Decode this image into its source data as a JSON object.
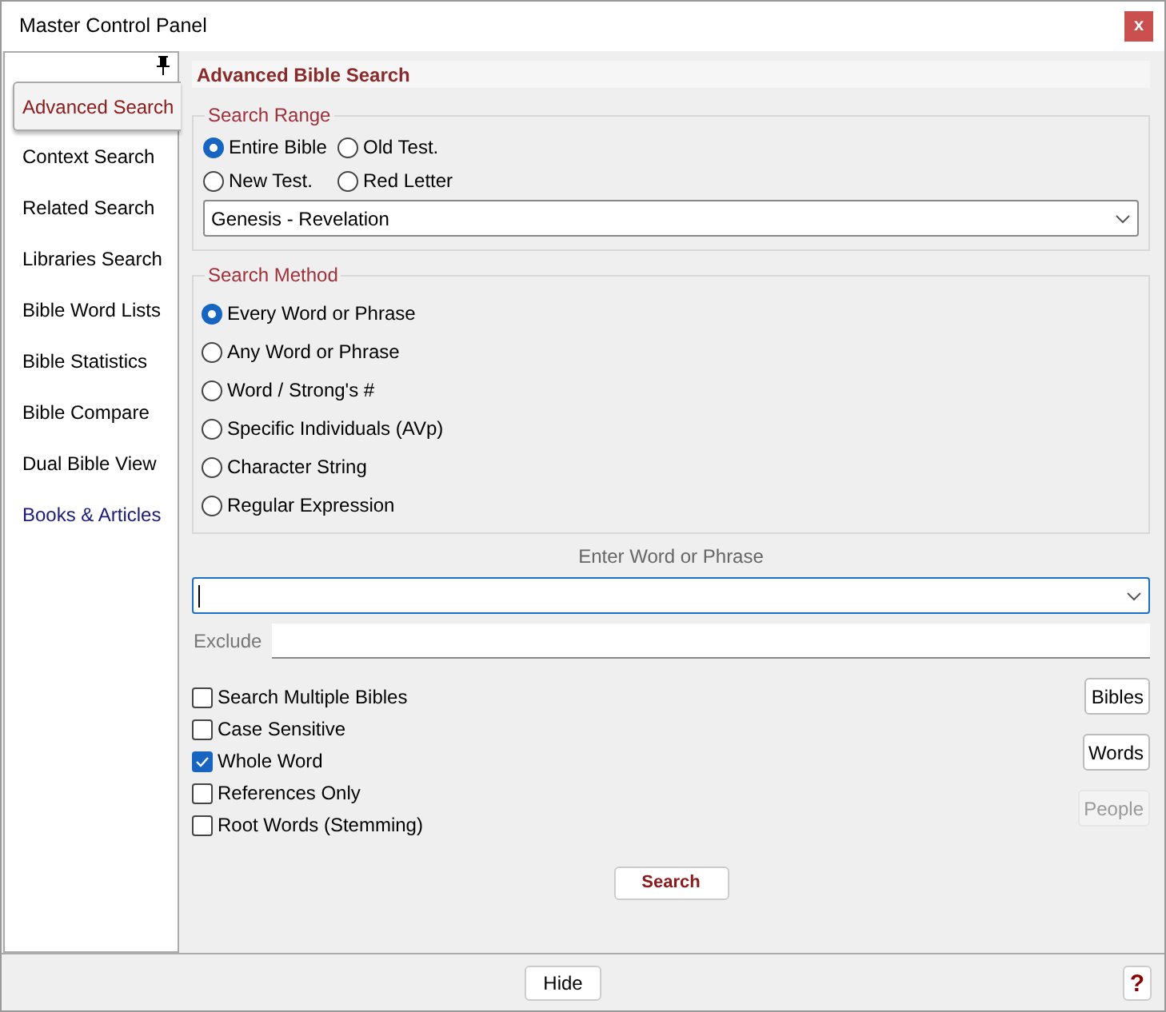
{
  "window": {
    "title": "Master Control Panel",
    "close": "x"
  },
  "sidebar": {
    "items": [
      {
        "label": "Advanced Search",
        "selected": true,
        "color": "#8b1a1a"
      },
      {
        "label": "Context Search",
        "selected": false,
        "color": "#000000"
      },
      {
        "label": "Related Search",
        "selected": false,
        "color": "#000000"
      },
      {
        "label": "Libraries Search",
        "selected": false,
        "color": "#000000"
      },
      {
        "label": "Bible Word Lists",
        "selected": false,
        "color": "#000000"
      },
      {
        "label": "Bible Statistics",
        "selected": false,
        "color": "#000000"
      },
      {
        "label": "Bible Compare",
        "selected": false,
        "color": "#000000"
      },
      {
        "label": "Dual Bible View",
        "selected": false,
        "color": "#000000"
      },
      {
        "label": "Books & Articles",
        "selected": false,
        "color": "#1a1a7a"
      }
    ]
  },
  "panel_title": "Advanced Bible Search",
  "search_range": {
    "title": "Search Range",
    "options": [
      {
        "label": "Entire Bible",
        "selected": true
      },
      {
        "label": "Old Test.",
        "selected": false
      },
      {
        "label": "New Test.",
        "selected": false
      },
      {
        "label": "Red Letter",
        "selected": false
      }
    ],
    "range": "Genesis - Revelation"
  },
  "search_method": {
    "title": "Search Method",
    "options": [
      {
        "label": "Every Word or Phrase",
        "selected": true
      },
      {
        "label": "Any Word or Phrase",
        "selected": false
      },
      {
        "label": "Word / Strong's #",
        "selected": false
      },
      {
        "label": "Specific Individuals (AVp)",
        "selected": false
      },
      {
        "label": "Character String",
        "selected": false
      },
      {
        "label": "Regular Expression",
        "selected": false
      }
    ]
  },
  "word_label": "Enter Word or Phrase",
  "exclude_label": "Exclude",
  "options": [
    {
      "label": "Search Multiple Bibles",
      "checked": false
    },
    {
      "label": "Case Sensitive",
      "checked": false
    },
    {
      "label": "Whole Word",
      "checked": true
    },
    {
      "label": "References Only",
      "checked": false
    },
    {
      "label": "Root Words (Stemming)",
      "checked": false
    }
  ],
  "side_buttons": [
    {
      "label": "Bibles",
      "disabled": false
    },
    {
      "label": "Words",
      "disabled": false
    },
    {
      "label": "People",
      "disabled": true
    }
  ],
  "search_button": "Search",
  "footer": {
    "hide": "Hide",
    "help": "?"
  }
}
